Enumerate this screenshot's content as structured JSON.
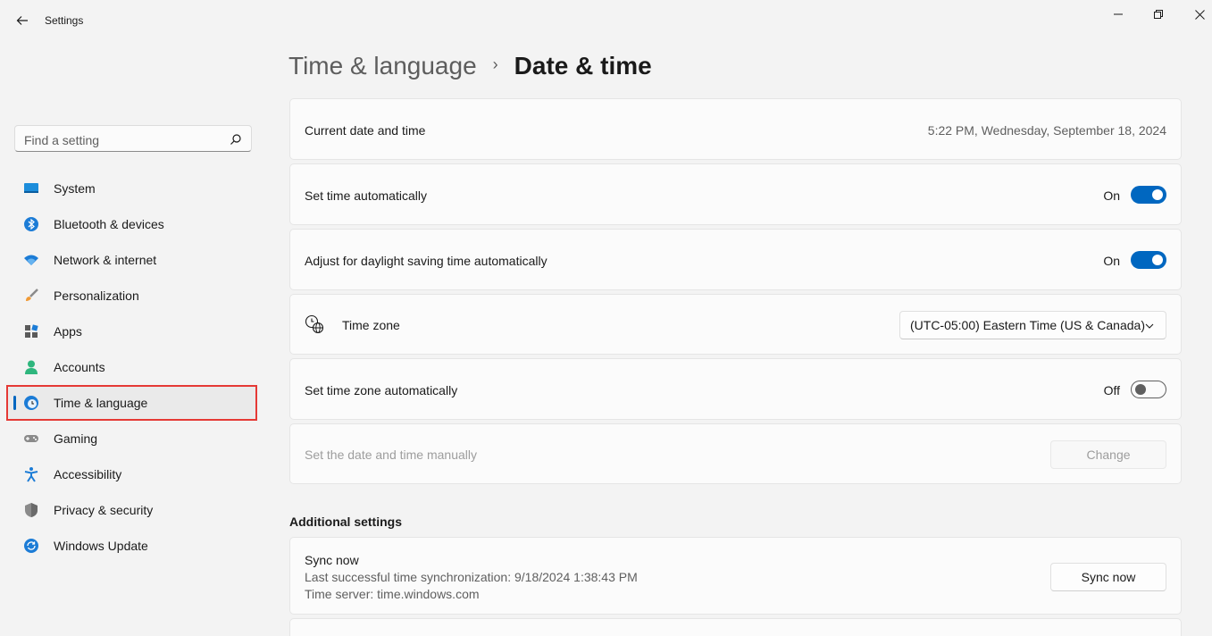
{
  "window": {
    "title": "Settings"
  },
  "search": {
    "placeholder": "Find a setting"
  },
  "sidebar": {
    "items": [
      {
        "label": "System",
        "icon": "system-icon"
      },
      {
        "label": "Bluetooth & devices",
        "icon": "bluetooth-icon"
      },
      {
        "label": "Network & internet",
        "icon": "wifi-icon"
      },
      {
        "label": "Personalization",
        "icon": "brush-icon"
      },
      {
        "label": "Apps",
        "icon": "apps-icon"
      },
      {
        "label": "Accounts",
        "icon": "account-icon"
      },
      {
        "label": "Time & language",
        "icon": "time-language-icon",
        "selected": true
      },
      {
        "label": "Gaming",
        "icon": "gamepad-icon"
      },
      {
        "label": "Accessibility",
        "icon": "accessibility-icon"
      },
      {
        "label": "Privacy & security",
        "icon": "shield-icon"
      },
      {
        "label": "Windows Update",
        "icon": "update-icon"
      }
    ]
  },
  "breadcrumb": {
    "parent": "Time & language",
    "separator": "›",
    "current": "Date & time"
  },
  "settings": {
    "current_datetime": {
      "label": "Current date and time",
      "value": "5:22 PM, Wednesday, September 18, 2024"
    },
    "set_time_auto": {
      "label": "Set time automatically",
      "state": "On"
    },
    "daylight_saving": {
      "label": "Adjust for daylight saving time automatically",
      "state": "On"
    },
    "time_zone": {
      "label": "Time zone",
      "value": "(UTC-05:00) Eastern Time (US & Canada)"
    },
    "time_zone_auto": {
      "label": "Set time zone automatically",
      "state": "Off"
    },
    "manual": {
      "label": "Set the date and time manually",
      "button": "Change"
    }
  },
  "additional": {
    "title": "Additional settings",
    "sync": {
      "label": "Sync now",
      "last_sync": "Last successful time synchronization: 9/18/2024 1:38:43 PM",
      "server": "Time server: time.windows.com",
      "button": "Sync now"
    }
  },
  "colors": {
    "accent": "#0067c0",
    "highlight": "#e53935",
    "background": "#f3f3f3",
    "card": "#fbfbfb"
  }
}
